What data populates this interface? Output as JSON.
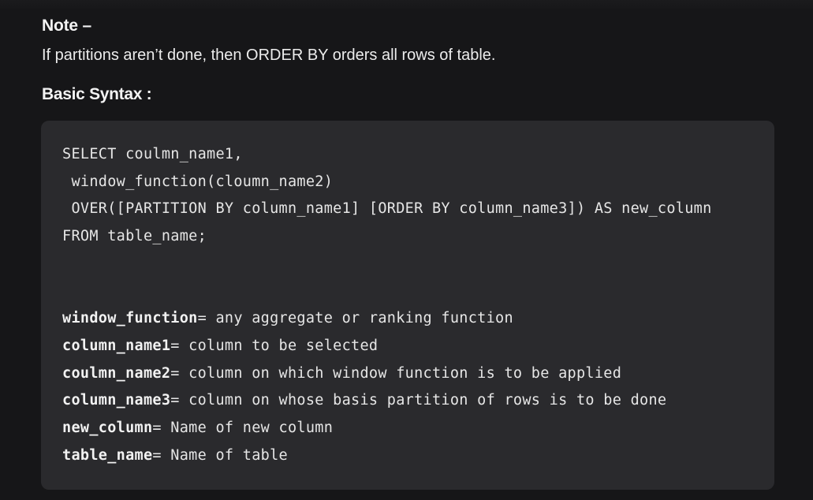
{
  "note": {
    "heading": "Note –",
    "text": "If partitions aren’t done, then ORDER BY orders all rows of table."
  },
  "syntax": {
    "heading": "Basic Syntax :"
  },
  "code": {
    "query_lines": [
      "SELECT coulmn_name1,",
      " window_function(cloumn_name2)",
      " OVER([PARTITION BY column_name1] [ORDER BY column_name3]) AS new_column",
      "FROM table_name;"
    ],
    "definitions": [
      {
        "term": "window_function",
        "desc": "= any aggregate or ranking function"
      },
      {
        "term": "column_name1",
        "desc": "= column to be selected"
      },
      {
        "term": "coulmn_name2",
        "desc": "= column on which window function is to be applied"
      },
      {
        "term": "column_name3",
        "desc": "= column on whose basis partition of rows is to be done"
      },
      {
        "term": "new_column",
        "desc": "= Name of new column"
      },
      {
        "term": "table_name",
        "desc": "= Name of table"
      }
    ]
  }
}
